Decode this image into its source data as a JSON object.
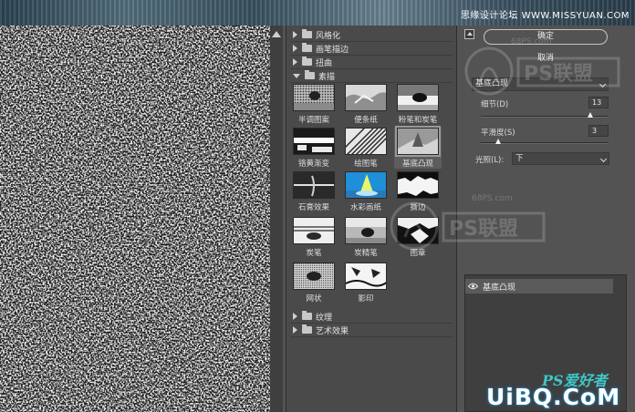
{
  "top": {
    "watermark": "思缘设计论坛 WWW.MISSYUAN.COM"
  },
  "gallery": {
    "folders_top": [
      {
        "label": "风格化"
      },
      {
        "label": "画笔描边"
      },
      {
        "label": "扭曲"
      },
      {
        "label": "素描",
        "open": true
      }
    ],
    "thumbs": [
      {
        "label": "半调图案"
      },
      {
        "label": "便条纸"
      },
      {
        "label": "粉笔和炭笔"
      },
      {
        "label": "铬黄渐变"
      },
      {
        "label": "绘图笔"
      },
      {
        "label": "基底凸现",
        "selected": true
      },
      {
        "label": "石膏效果"
      },
      {
        "label": "水彩画纸"
      },
      {
        "label": "撕边"
      },
      {
        "label": "炭笔"
      },
      {
        "label": "炭精笔"
      },
      {
        "label": "图章"
      },
      {
        "label": "网状"
      },
      {
        "label": "影印"
      }
    ],
    "folders_bottom": [
      {
        "label": "纹理"
      },
      {
        "label": "艺术效果"
      }
    ]
  },
  "controls": {
    "ok_label": "确定",
    "cancel_label": "取消",
    "filter_select": "基底凸现",
    "detail": {
      "label": "细节(D)",
      "value": "13",
      "min": 1,
      "max": 15
    },
    "smoothness": {
      "label": "平滑度(S)",
      "value": "3",
      "min": 1,
      "max": 15
    },
    "light": {
      "label": "光照(L):",
      "value": "下"
    }
  },
  "layers": {
    "items": [
      {
        "name": "基底凸现"
      }
    ]
  },
  "watermarks": {
    "site1": "68PS.com",
    "site2": "68PS.com",
    "ps_brand": "PS爱好者",
    "uibq": "UiBQ.CoM"
  }
}
